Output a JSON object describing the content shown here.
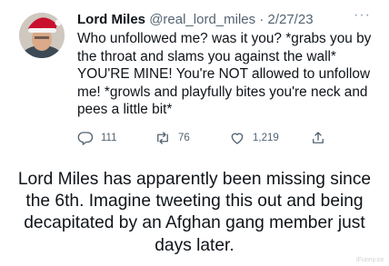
{
  "tweet": {
    "author_name": "Lord Miles",
    "handle": "@real_lord_miles",
    "separator": "·",
    "date": "2/27/23",
    "more": "···",
    "text": "Who unfollowed me? was it you? *grabs you by the throat and slams you against the wall* YOU'RE MINE! You're NOT allowed to unfollow me! *growls and playfully bites you're neck and pees a little bit*",
    "actions": {
      "replies": "111",
      "retweets": "76",
      "likes": "1,219"
    }
  },
  "caption": "Lord Miles has apparently been missing since the 6th. Imagine tweeting this out and being decapitated by an Afghan gang member just days later.",
  "watermark": "iFunny.co",
  "icons": {
    "reply": "reply-icon",
    "retweet": "retweet-icon",
    "like": "heart-icon",
    "share": "share-icon",
    "more": "more-options-icon"
  },
  "colors": {
    "text": "#0f1419",
    "secondary": "#536471",
    "santa_hat_red": "#c8102e"
  }
}
